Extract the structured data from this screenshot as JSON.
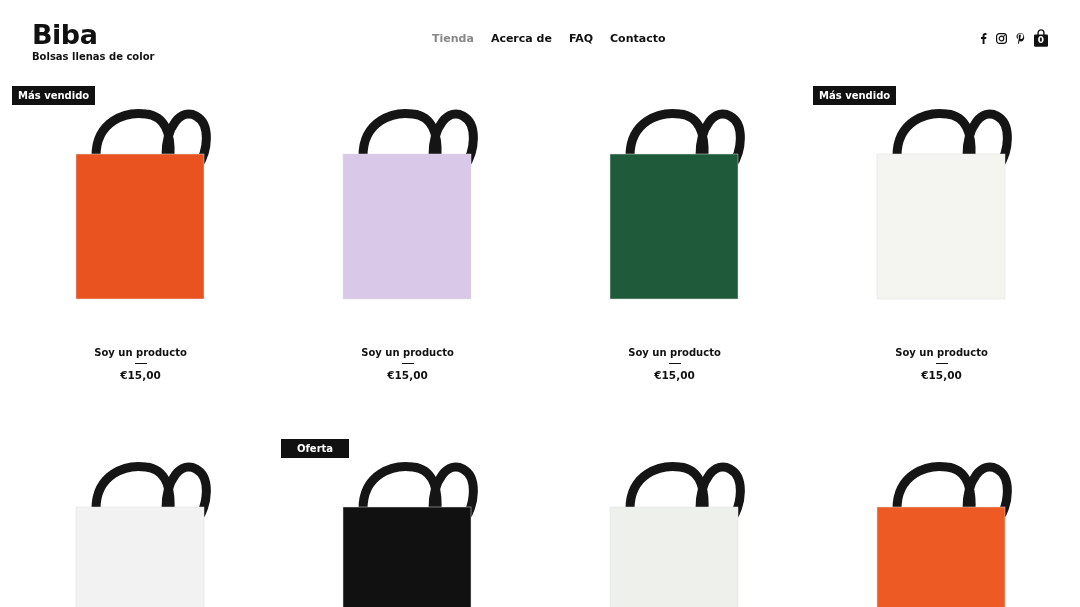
{
  "header": {
    "logo": "Biba",
    "tagline": "Bolsas llenas de color",
    "nav": [
      {
        "label": "Tienda",
        "selected": true
      },
      {
        "label": "Acerca de",
        "selected": false
      },
      {
        "label": "FAQ",
        "selected": false
      },
      {
        "label": "Contacto",
        "selected": false
      }
    ],
    "cart_count": "0"
  },
  "products": [
    {
      "badge": "Más vendido",
      "color": "#e8531f",
      "name": "Soy un producto",
      "price": "€15,00"
    },
    {
      "color": "#d9c8e8",
      "name": "Soy un producto",
      "price": "€15,00"
    },
    {
      "color": "#1f5a3a",
      "name": "Soy un producto",
      "price": "€15,00"
    },
    {
      "badge": "Más vendido",
      "color": "#f4f4f0",
      "name": "Soy un producto",
      "price": "€15,00"
    },
    {
      "color": "#f2f2f2"
    },
    {
      "badge": "Oferta",
      "color": "#111111"
    },
    {
      "color": "#eef0ec"
    },
    {
      "color": "#ee5a24"
    }
  ]
}
